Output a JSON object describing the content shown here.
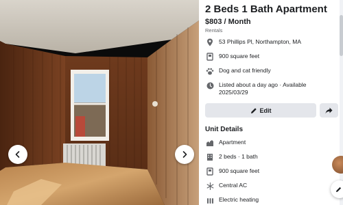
{
  "listing": {
    "title": "2 Beds 1 Bath Apartment",
    "price": "$803 / Month",
    "category": "Rentals",
    "info": [
      {
        "icon": "location-pin-icon",
        "text": "53 Phillips Pl, Northampton, MA"
      },
      {
        "icon": "square-feet-icon",
        "text": "900 square feet"
      },
      {
        "icon": "paw-icon",
        "text": "Dog and cat friendly"
      },
      {
        "icon": "clock-icon",
        "text": "Listed about a day ago · Available 2025/03/29"
      }
    ],
    "actions": {
      "edit_label": "Edit",
      "share_icon": "share-icon"
    }
  },
  "unit_details": {
    "heading": "Unit Details",
    "items": [
      {
        "icon": "apartment-icon",
        "text": "Apartment"
      },
      {
        "icon": "building-icon",
        "text": "2 beds · 1 bath"
      },
      {
        "icon": "square-feet-icon",
        "text": "900 square feet"
      },
      {
        "icon": "snowflake-icon",
        "text": "Central AC"
      },
      {
        "icon": "heating-icon",
        "text": "Electric heating"
      }
    ]
  },
  "gallery": {
    "prev_icon": "chevron-left-icon",
    "next_icon": "chevron-right-icon"
  },
  "colors": {
    "accent_button_bg": "#e4e6eb",
    "muted_text": "#65676b",
    "icon_gray": "#65676b"
  }
}
